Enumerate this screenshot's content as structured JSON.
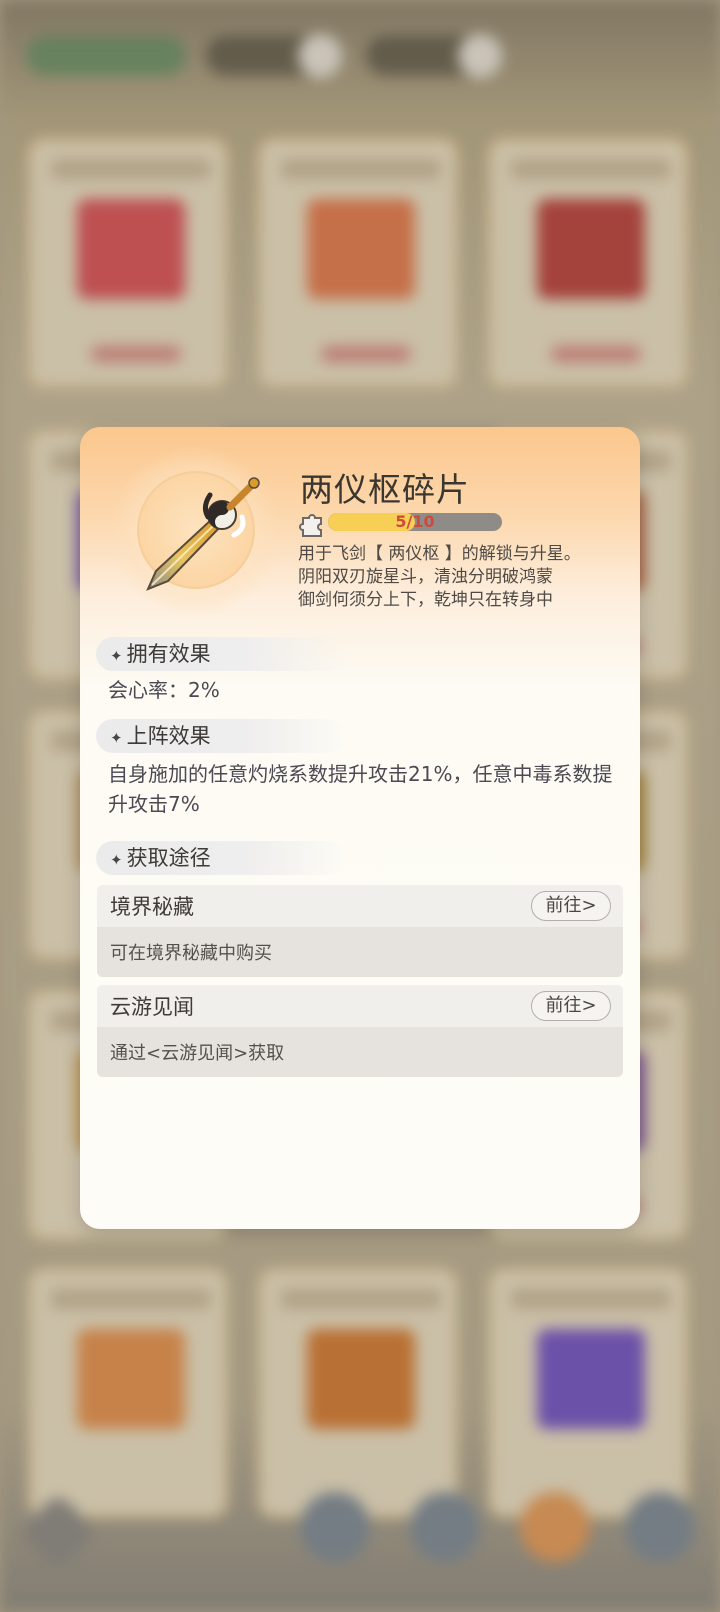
{
  "item": {
    "title": "两仪枢碎片",
    "progress_text": "5/10",
    "progress_fraction": 0.5,
    "icon": "sword-icon",
    "description_lines": [
      "用于飞剑【 两仪枢 】的解锁与升星。",
      "阴阳双刃旋星斗，清浊分明破鸿蒙",
      "御剑何须分上下，乾坤只在转身中"
    ]
  },
  "sections": {
    "owned": {
      "title": "拥有效果",
      "text": "会心率：2%"
    },
    "deployed": {
      "title": "上阵效果",
      "text": "自身施加的任意灼烧系数提升攻击21%，任意中毒系数提升攻击7%"
    },
    "acquire": {
      "title": "获取途径",
      "routes": [
        {
          "name": "境界秘藏",
          "button": "前往>",
          "desc": "可在境界秘藏中购买"
        },
        {
          "name": "云游见闻",
          "button": "前往>",
          "desc": "通过<云游见闻>获取"
        }
      ]
    }
  },
  "colors": {
    "popup_top": "#fbc78d",
    "progress_fill": "#f7cf55",
    "progress_text": "#cf4a3c"
  }
}
